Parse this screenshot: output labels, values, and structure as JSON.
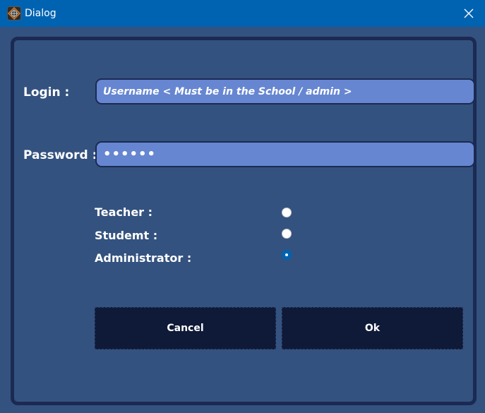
{
  "window": {
    "title": "Dialog",
    "app_icon": "app-compass-icon",
    "close_icon": "close-icon"
  },
  "form": {
    "login_label": "Login :",
    "login_placeholder": "Username < Must be in the School / admin >",
    "password_label": "Password :",
    "password_value": "••••••"
  },
  "roles": [
    {
      "label": "Teacher :",
      "checked": false
    },
    {
      "label": "Studemt :",
      "checked": false
    },
    {
      "label": "Administrator :",
      "checked": true
    }
  ],
  "buttons": {
    "cancel_label": "Cancel",
    "ok_label": "Ok"
  },
  "colors": {
    "titlebar": "#0063b1",
    "background": "#34527f",
    "field": "#6686d1",
    "button": "#0f1a38",
    "radio_selected": "#0063b1"
  }
}
